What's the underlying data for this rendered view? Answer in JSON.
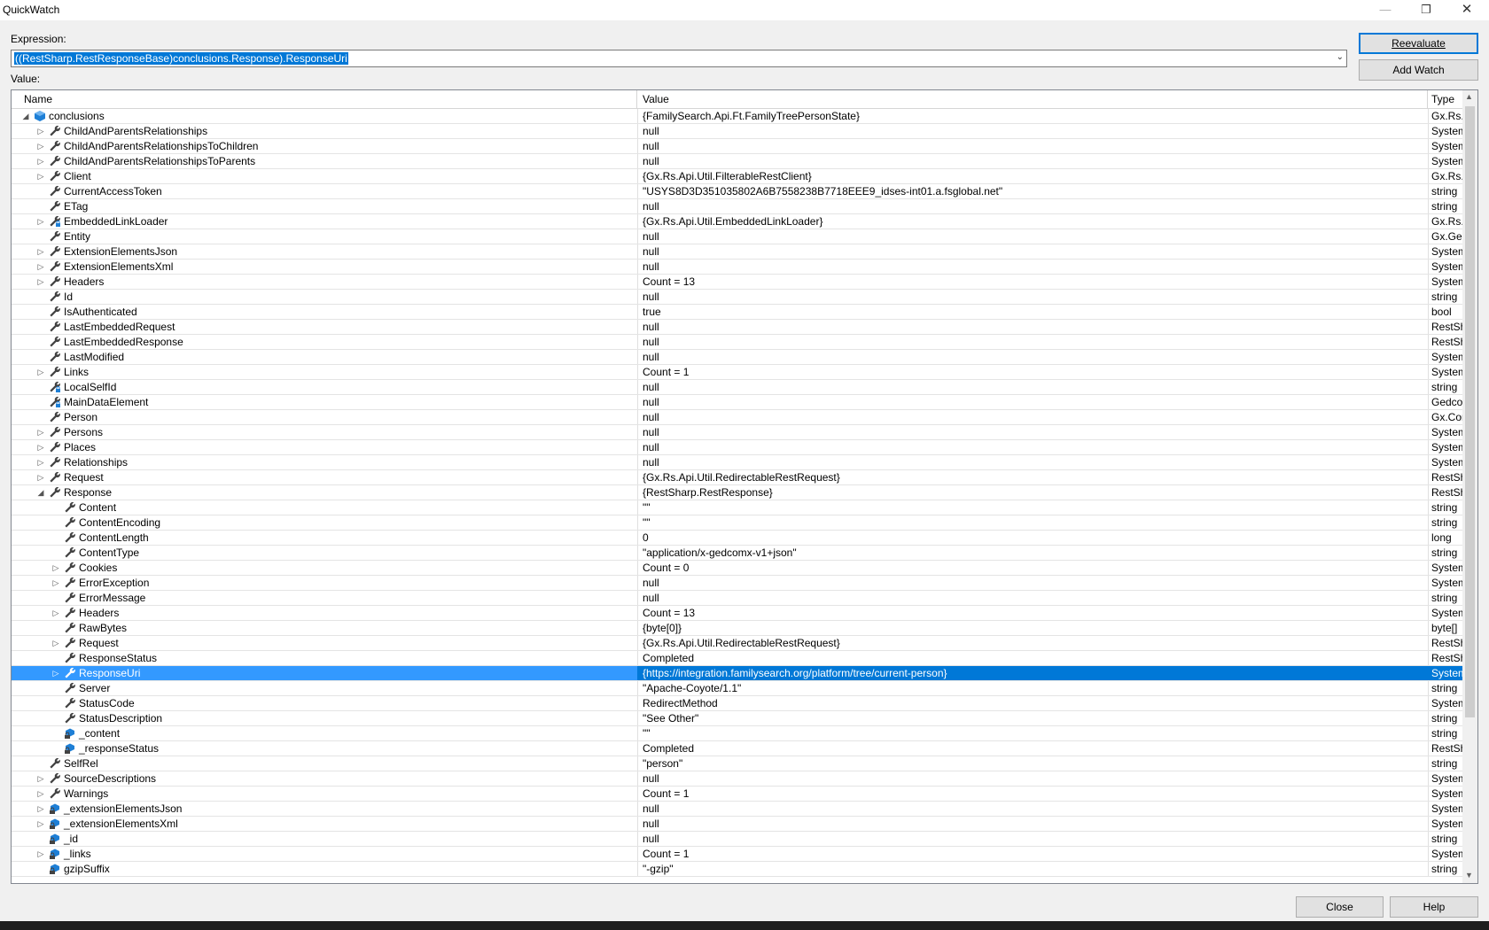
{
  "window": {
    "title": "QuickWatch"
  },
  "expression": {
    "label": "Expression:",
    "value": "((RestSharp.RestResponseBase)conclusions.Response).ResponseUri"
  },
  "value_label": "Value:",
  "buttons": {
    "reevaluate": "Reevaluate",
    "add_watch": "Add Watch",
    "close": "Close",
    "help": "Help"
  },
  "columns": {
    "name": "Name",
    "value": "Value",
    "type": "Type"
  },
  "colors": {
    "selection": "#0078d7",
    "accent": "#0078d7"
  },
  "rows": [
    {
      "name": "conclusions",
      "value": "{FamilySearch.Api.Ft.FamilyTreePersonState}",
      "type": "Gx.Rs.Ap",
      "level": 0,
      "exp": "open",
      "icon": "object"
    },
    {
      "name": "ChildAndParentsRelationships",
      "value": "null",
      "type": "System.C",
      "level": 1,
      "exp": "closed",
      "icon": "wrench"
    },
    {
      "name": "ChildAndParentsRelationshipsToChildren",
      "value": "null",
      "type": "System.C",
      "level": 1,
      "exp": "closed",
      "icon": "wrench"
    },
    {
      "name": "ChildAndParentsRelationshipsToParents",
      "value": "null",
      "type": "System.C",
      "level": 1,
      "exp": "closed",
      "icon": "wrench"
    },
    {
      "name": "Client",
      "value": "{Gx.Rs.Api.Util.FilterableRestClient}",
      "type": "Gx.Rs.Ap",
      "level": 1,
      "exp": "closed",
      "icon": "wrench"
    },
    {
      "name": "CurrentAccessToken",
      "value": "\"USYS8D3D351035802A6B7558238B7718EEE9_idses-int01.a.fsglobal.net\"",
      "type": "string",
      "level": 1,
      "exp": "",
      "icon": "wrench",
      "mag": true
    },
    {
      "name": "ETag",
      "value": "null",
      "type": "string",
      "level": 1,
      "exp": "",
      "icon": "wrench"
    },
    {
      "name": "EmbeddedLinkLoader",
      "value": "{Gx.Rs.Api.Util.EmbeddedLinkLoader}",
      "type": "Gx.Rs.Ap",
      "level": 1,
      "exp": "closed",
      "icon": "wrench-lock"
    },
    {
      "name": "Entity",
      "value": "null",
      "type": "Gx.Gedc",
      "level": 1,
      "exp": "",
      "icon": "wrench"
    },
    {
      "name": "ExtensionElementsJson",
      "value": "null",
      "type": "System.C",
      "level": 1,
      "exp": "closed",
      "icon": "wrench"
    },
    {
      "name": "ExtensionElementsXml",
      "value": "null",
      "type": "System.C",
      "level": 1,
      "exp": "closed",
      "icon": "wrench"
    },
    {
      "name": "Headers",
      "value": "Count = 13",
      "type": "System.C",
      "level": 1,
      "exp": "closed",
      "icon": "wrench"
    },
    {
      "name": "Id",
      "value": "null",
      "type": "string",
      "level": 1,
      "exp": "",
      "icon": "wrench"
    },
    {
      "name": "IsAuthenticated",
      "value": "true",
      "type": "bool",
      "level": 1,
      "exp": "",
      "icon": "wrench"
    },
    {
      "name": "LastEmbeddedRequest",
      "value": "null",
      "type": "RestShar",
      "level": 1,
      "exp": "",
      "icon": "wrench"
    },
    {
      "name": "LastEmbeddedResponse",
      "value": "null",
      "type": "RestShar",
      "level": 1,
      "exp": "",
      "icon": "wrench"
    },
    {
      "name": "LastModified",
      "value": "null",
      "type": "System.D",
      "level": 1,
      "exp": "",
      "icon": "wrench"
    },
    {
      "name": "Links",
      "value": "Count = 1",
      "type": "System.C",
      "level": 1,
      "exp": "closed",
      "icon": "wrench"
    },
    {
      "name": "LocalSelfId",
      "value": "null",
      "type": "string",
      "level": 1,
      "exp": "",
      "icon": "wrench-lock"
    },
    {
      "name": "MainDataElement",
      "value": "null",
      "type": "Gedcom",
      "level": 1,
      "exp": "",
      "icon": "wrench-lock"
    },
    {
      "name": "Person",
      "value": "null",
      "type": "Gx.Conc",
      "level": 1,
      "exp": "",
      "icon": "wrench"
    },
    {
      "name": "Persons",
      "value": "null",
      "type": "System.C",
      "level": 1,
      "exp": "closed",
      "icon": "wrench"
    },
    {
      "name": "Places",
      "value": "null",
      "type": "System.C",
      "level": 1,
      "exp": "closed",
      "icon": "wrench"
    },
    {
      "name": "Relationships",
      "value": "null",
      "type": "System.C",
      "level": 1,
      "exp": "closed",
      "icon": "wrench"
    },
    {
      "name": "Request",
      "value": "{Gx.Rs.Api.Util.RedirectableRestRequest}",
      "type": "RestShar",
      "level": 1,
      "exp": "closed",
      "icon": "wrench"
    },
    {
      "name": "Response",
      "value": "{RestSharp.RestResponse}",
      "type": "RestShar",
      "level": 1,
      "exp": "open",
      "icon": "wrench"
    },
    {
      "name": "Content",
      "value": "\"\"",
      "type": "string",
      "level": 2,
      "exp": "",
      "icon": "wrench",
      "mag": true
    },
    {
      "name": "ContentEncoding",
      "value": "\"\"",
      "type": "string",
      "level": 2,
      "exp": "",
      "icon": "wrench",
      "mag": true
    },
    {
      "name": "ContentLength",
      "value": "0",
      "type": "long",
      "level": 2,
      "exp": "",
      "icon": "wrench"
    },
    {
      "name": "ContentType",
      "value": "\"application/x-gedcomx-v1+json\"",
      "type": "string",
      "level": 2,
      "exp": "",
      "icon": "wrench",
      "mag": true
    },
    {
      "name": "Cookies",
      "value": "Count = 0",
      "type": "System.C",
      "level": 2,
      "exp": "closed",
      "icon": "wrench"
    },
    {
      "name": "ErrorException",
      "value": "null",
      "type": "System.E",
      "level": 2,
      "exp": "closed",
      "icon": "wrench"
    },
    {
      "name": "ErrorMessage",
      "value": "null",
      "type": "string",
      "level": 2,
      "exp": "",
      "icon": "wrench"
    },
    {
      "name": "Headers",
      "value": "Count = 13",
      "type": "System.C",
      "level": 2,
      "exp": "closed",
      "icon": "wrench"
    },
    {
      "name": "RawBytes",
      "value": "{byte[0]}",
      "type": "byte[]",
      "level": 2,
      "exp": "",
      "icon": "wrench"
    },
    {
      "name": "Request",
      "value": "{Gx.Rs.Api.Util.RedirectableRestRequest}",
      "type": "RestShar",
      "level": 2,
      "exp": "closed",
      "icon": "wrench"
    },
    {
      "name": "ResponseStatus",
      "value": "Completed",
      "type": "RestShar",
      "level": 2,
      "exp": "",
      "icon": "wrench"
    },
    {
      "name": "ResponseUri",
      "value": "{https://integration.familysearch.org/platform/tree/current-person}",
      "type": "System.U",
      "level": 2,
      "exp": "closed",
      "icon": "wrench",
      "selected": true
    },
    {
      "name": "Server",
      "value": "\"Apache-Coyote/1.1\"",
      "type": "string",
      "level": 2,
      "exp": "",
      "icon": "wrench",
      "mag": true
    },
    {
      "name": "StatusCode",
      "value": "RedirectMethod",
      "type": "System.N",
      "level": 2,
      "exp": "",
      "icon": "wrench"
    },
    {
      "name": "StatusDescription",
      "value": "\"See Other\"",
      "type": "string",
      "level": 2,
      "exp": "",
      "icon": "wrench",
      "mag": true
    },
    {
      "name": "_content",
      "value": "\"\"",
      "type": "string",
      "level": 2,
      "exp": "",
      "icon": "field-lock",
      "mag": true
    },
    {
      "name": "_responseStatus",
      "value": "Completed",
      "type": "RestShar",
      "level": 2,
      "exp": "",
      "icon": "field-lock"
    },
    {
      "name": "SelfRel",
      "value": "\"person\"",
      "type": "string",
      "level": 1,
      "exp": "",
      "icon": "wrench",
      "mag": true
    },
    {
      "name": "SourceDescriptions",
      "value": "null",
      "type": "System.C",
      "level": 1,
      "exp": "closed",
      "icon": "wrench"
    },
    {
      "name": "Warnings",
      "value": "Count = 1",
      "type": "System.C",
      "level": 1,
      "exp": "closed",
      "icon": "wrench"
    },
    {
      "name": "_extensionElementsJson",
      "value": "null",
      "type": "System.C",
      "level": 1,
      "exp": "closed",
      "icon": "field-lock"
    },
    {
      "name": "_extensionElementsXml",
      "value": "null",
      "type": "System.C",
      "level": 1,
      "exp": "closed",
      "icon": "field-lock"
    },
    {
      "name": "_id",
      "value": "null",
      "type": "string",
      "level": 1,
      "exp": "",
      "icon": "field-lock"
    },
    {
      "name": "_links",
      "value": "Count = 1",
      "type": "System.C",
      "level": 1,
      "exp": "closed",
      "icon": "field-lock"
    },
    {
      "name": "gzipSuffix",
      "value": "\"-gzip\"",
      "type": "string",
      "level": 1,
      "exp": "",
      "icon": "field-lock",
      "mag": true
    }
  ]
}
